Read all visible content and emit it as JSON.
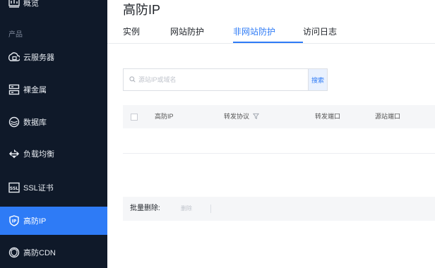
{
  "sidebar": {
    "top_item": {
      "label": "概览",
      "icon": "overview-icon"
    },
    "section_label": "产品",
    "items": [
      {
        "label": "云服务器",
        "icon": "cloud-server-icon"
      },
      {
        "label": "裸金属",
        "icon": "bare-metal-icon"
      },
      {
        "label": "数据库",
        "icon": "database-icon"
      },
      {
        "label": "负载均衡",
        "icon": "load-balancer-icon"
      },
      {
        "label": "SSL证书",
        "icon": "ssl-certificate-icon"
      },
      {
        "label": "高防IP",
        "icon": "anti-ddos-ip-icon",
        "active": true
      },
      {
        "label": "高防CDN",
        "icon": "anti-ddos-cdn-icon"
      }
    ]
  },
  "main": {
    "title": "高防IP",
    "tabs": [
      {
        "label": "实例"
      },
      {
        "label": "网站防护"
      },
      {
        "label": "非网站防护",
        "active": true
      },
      {
        "label": "访问日志"
      }
    ],
    "search": {
      "placeholder": "源站IP或域名",
      "value": "",
      "button_label": "搜索"
    },
    "table": {
      "columns": [
        "高防IP",
        "转发协议",
        "转发端口",
        "源站端口"
      ],
      "rows": []
    },
    "batch": {
      "label": "批量删除:",
      "delete_label": "删除"
    }
  },
  "colors": {
    "sidebar_bg": "#0f1929",
    "accent": "#2e7bf6",
    "active_item_bg": "#2e7bf6"
  }
}
